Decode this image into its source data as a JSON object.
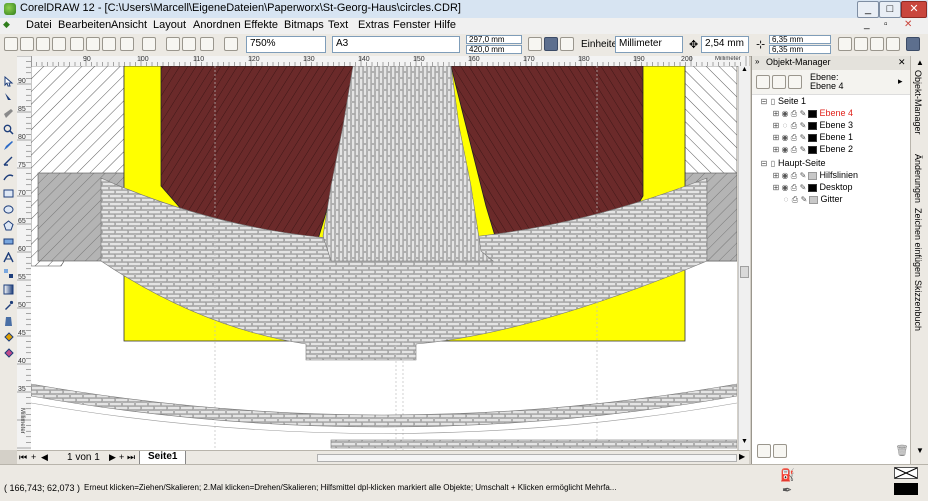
{
  "window": {
    "title": "CorelDRAW 12 - [C:\\Users\\Marcell\\EigeneDateien\\Paperworx\\St-Georg-Haus\\circles.CDR]",
    "minimize": "_",
    "maximize": "□",
    "close": "✕"
  },
  "menu": [
    "Datei",
    "Bearbeiten",
    "Ansicht",
    "Layout",
    "Anordnen",
    "Effekte",
    "Bitmaps",
    "Text",
    "Extras",
    "Fenster",
    "Hilfe"
  ],
  "toolbar": {
    "zoom": "750%",
    "paper_size": "A3",
    "width": "297,0 mm",
    "height": "420,0 mm",
    "units_label": "Einheiten:",
    "units_value": "Millimeter",
    "nudge": "2,54 mm",
    "dup_x": "6,35 mm",
    "dup_y": "6,35 mm"
  },
  "ruler": {
    "unit": "Millimeter",
    "left_unit": "Millimeter",
    "top_ticks": [
      "90",
      "100",
      "110",
      "120",
      "130",
      "140",
      "150",
      "160",
      "170",
      "180",
      "190",
      "200"
    ],
    "left_ticks": [
      "90",
      "85",
      "80",
      "75",
      "70",
      "65",
      "60",
      "55",
      "50",
      "45",
      "40",
      "35"
    ]
  },
  "object_manager": {
    "title": "Objekt-Manager",
    "layer_label": "Ebene:",
    "layer_value": "Ebene 4",
    "tree": [
      {
        "label": "Seite 1",
        "indent": 0,
        "swatch": "",
        "color": "#000000"
      },
      {
        "label": "Ebene 4",
        "indent": 1,
        "swatch": "#000000",
        "color": "#e0221b"
      },
      {
        "label": "Ebene 3",
        "indent": 1,
        "swatch": "#000000",
        "color": "#000000"
      },
      {
        "label": "Ebene 1",
        "indent": 1,
        "swatch": "#000000",
        "color": "#000000"
      },
      {
        "label": "Ebene 2",
        "indent": 1,
        "swatch": "#000000",
        "color": "#000000"
      },
      {
        "label": "Haupt-Seite",
        "indent": 0,
        "swatch": "",
        "color": "#000000"
      },
      {
        "label": "Hilfslinien",
        "indent": 1,
        "swatch": "#c8c8c8",
        "color": "#000000"
      },
      {
        "label": "Desktop",
        "indent": 1,
        "swatch": "#000000",
        "color": "#000000"
      },
      {
        "label": "Gitter",
        "indent": 1,
        "swatch": "#c8c8c8",
        "color": "#000000"
      }
    ]
  },
  "side_tabs": [
    "Objekt-Manager",
    "Änderungen",
    "Zeichen einfügen",
    "Skizzenbuch"
  ],
  "pages": {
    "counter": "1 von 1",
    "tab": "Seite1"
  },
  "status": {
    "coords": "( 166,743; 62,073 )",
    "hint": "Erneut klicken=Ziehen/Skalieren; 2.Mal klicken=Drehen/Skalieren; Hilfsmittel dpl-klicken markiert alle Objekte; Umschalt + Klicken ermöglicht Mehrfa..."
  },
  "colors": {
    "brown": "#6b2a2a",
    "yellow": "#ffff00",
    "stone": "#dcdcdc",
    "grey": "#b4b4b4"
  }
}
